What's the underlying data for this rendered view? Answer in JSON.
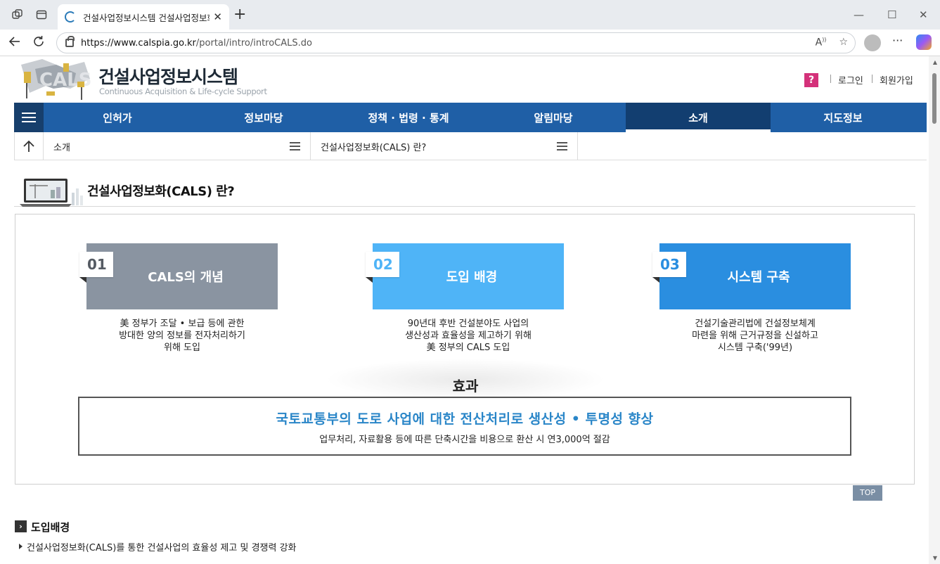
{
  "browser": {
    "tab_title": "건설사업정보시스템 건설사업정보화",
    "url_host": "https://www.calspia.go.kr",
    "url_path": "/portal/intro/introCALS.do",
    "icons": [
      "workspaces-icon",
      "tab-actions-icon",
      "close-icon",
      "new-tab-icon",
      "minimize-icon",
      "maximize-icon",
      "window-close-icon",
      "back-icon",
      "refresh-icon",
      "lock-icon",
      "read-aloud-icon",
      "favorite-icon",
      "profile-icon",
      "more-icon",
      "copilot-icon"
    ]
  },
  "header": {
    "title": "건설사업정보시스템",
    "subtitle": "Continuous Acquisition & Life-cycle Support",
    "help_icon": "?",
    "login": "로그인",
    "signup": "회원가입"
  },
  "gnb": {
    "items": [
      {
        "label": "인허가"
      },
      {
        "label": "정보마당"
      },
      {
        "label": "정책 · 법령 · 통계"
      },
      {
        "label": "알림마당"
      },
      {
        "label": "소개"
      },
      {
        "label": "지도정보"
      }
    ],
    "active": "소개"
  },
  "lnb": {
    "depth1": "소개",
    "depth2": "건설사업정보화(CALS) 란?"
  },
  "page": {
    "title": "건설사업정보화(CALS) 란?"
  },
  "cards": [
    {
      "num": "01",
      "title": "CALS의 개념",
      "color": "#8a94a1",
      "num_color": "#555b63",
      "desc": [
        "美 정부가 조달 • 보급 등에 관한",
        "방대한 양의 정보를 전자처리하기",
        "위해 도입"
      ]
    },
    {
      "num": "02",
      "title": "도입 배경",
      "color": "#4fb4f7",
      "num_color": "#4fb4f7",
      "desc": [
        "90년대 후반 건설분야도 사업의",
        "생산성과 효율성을 제고하기 위해",
        "美 정부의 CALS 도입"
      ]
    },
    {
      "num": "03",
      "title": "시스템 구축",
      "color": "#2a8ee0",
      "num_color": "#2a8ee0",
      "desc": [
        "건설기술관리법에 건설정보체계",
        "마련을 위해 근거규정을 신설하고",
        "시스템 구축('99년)"
      ]
    }
  ],
  "effect": {
    "label": "효과",
    "main": "국토교통부의 도로 사업에 대한 전산처리로 생산성 • 투명성 향상",
    "sub": "업무처리, 자료활용 등에 따른 단축시간을 비용으로 환산 시 연3,000억 절감"
  },
  "top_button": "TOP",
  "section": {
    "title": "도입배경",
    "bullet": "건설사업정보화(CALS)를 통한 건설사업의 효율성 제고 및 경쟁력 강화"
  }
}
